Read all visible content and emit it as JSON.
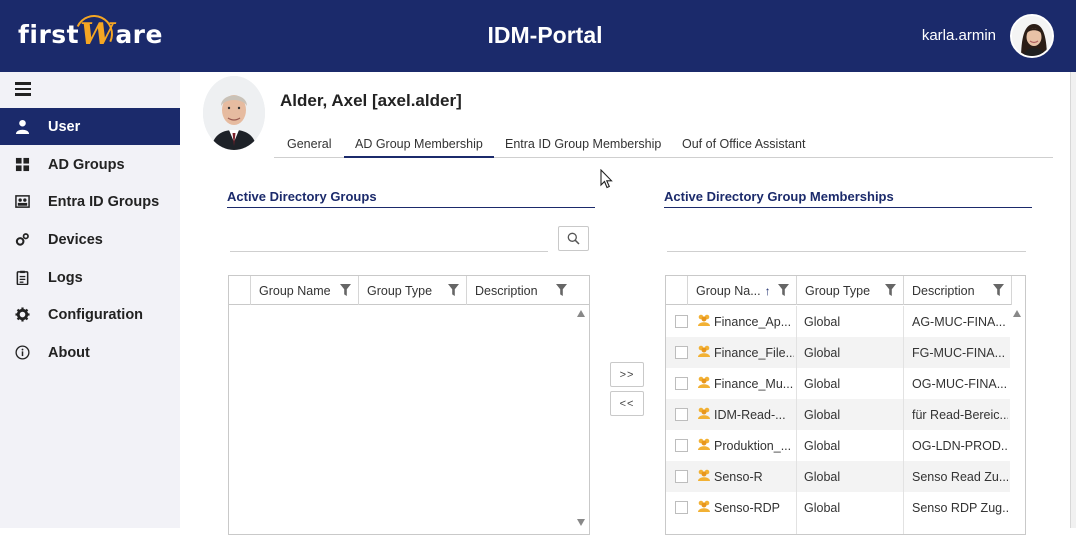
{
  "header": {
    "logo_first": "first",
    "logo_w": "W",
    "logo_rest": "are",
    "title": "IDM-Portal",
    "username": "karla.armin",
    "bg_color": "#1b2a6b",
    "logo_accent": "#f5a623"
  },
  "sidebar": {
    "toggle_icon": "hamburger-icon",
    "items": [
      {
        "label": "User",
        "icon": "user-icon",
        "active": true
      },
      {
        "label": "AD Groups",
        "icon": "grid-icon",
        "active": false
      },
      {
        "label": "Entra ID Groups",
        "icon": "groups-icon",
        "active": false
      },
      {
        "label": "Devices",
        "icon": "gears-icon",
        "active": false
      },
      {
        "label": "Logs",
        "icon": "clipboard-icon",
        "active": false
      },
      {
        "label": "Configuration",
        "icon": "gear-icon",
        "active": false
      },
      {
        "label": "About",
        "icon": "info-icon",
        "active": false
      }
    ]
  },
  "profile": {
    "name": "Alder, Axel [axel.alder]"
  },
  "tabs": [
    {
      "label": "General",
      "active": false
    },
    {
      "label": "AD Group Membership",
      "active": true
    },
    {
      "label": "Entra ID Group Membership",
      "active": false
    },
    {
      "label": "Ouf of Office Assistant",
      "active": false
    }
  ],
  "left_panel": {
    "title": "Active Directory Groups",
    "search_icon": "search-icon",
    "columns": [
      "Group Name",
      "Group Type",
      "Description"
    ],
    "rows": []
  },
  "transfer": {
    "add_label": ">>",
    "remove_label": "<<"
  },
  "right_panel": {
    "title": "Active Directory Group Memberships",
    "columns": [
      "Group Na...",
      "Group Type",
      "Description"
    ],
    "sort_icon": "sort-ascending-icon",
    "rows": [
      {
        "name": "Finance_Ap...",
        "type": "Global",
        "description": "AG-MUC-FINA..."
      },
      {
        "name": "Finance_File...",
        "type": "Global",
        "description": "FG-MUC-FINA..."
      },
      {
        "name": "Finance_Mu...",
        "type": "Global",
        "description": "OG-MUC-FINA..."
      },
      {
        "name": "IDM-Read-...",
        "type": "Global",
        "description": "für Read-Bereic..."
      },
      {
        "name": "Produktion_...",
        "type": "Global",
        "description": "OG-LDN-PROD..."
      },
      {
        "name": "Senso-R",
        "type": "Global",
        "description": "Senso Read Zu..."
      },
      {
        "name": "Senso-RDP",
        "type": "Global",
        "description": "Senso RDP Zug..."
      }
    ]
  }
}
